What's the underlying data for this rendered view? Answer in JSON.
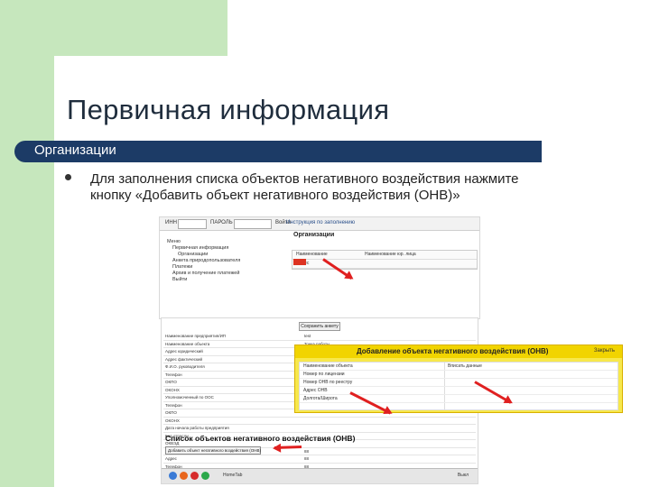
{
  "slide": {
    "title": "Первичная информация",
    "section": "Организации",
    "bullet": "Для заполнения списка объектов негативного воздействия нажмите кнопку «Добавить объект негативного воздействия (ОНВ)»"
  },
  "shot1": {
    "field_inn_label": "ИНН",
    "field_password_label": "ПАРОЛЬ",
    "login_button": "Войти",
    "help_link": "Инструкция по заполнению",
    "tree": [
      "Меню",
      "Первичная информация",
      "Организации",
      "Анкета природопользователя",
      "Платежи",
      "Архив и получение платежей",
      "Выйти"
    ],
    "org_title": "Организации",
    "table_rows": [
      {
        "c1": "Наименование",
        "c2": "Наименование юр. лица"
      },
      {
        "c1": "Адрес",
        "c2": ""
      }
    ]
  },
  "shot2": {
    "save_button": "Сохранить анкету",
    "form_rows": [
      {
        "label": "Наименование предприятия/ИП",
        "value": "test"
      },
      {
        "label": "Наименование объекта",
        "value": "Точка работы"
      },
      {
        "label": "Адрес юридический",
        "value": ""
      },
      {
        "label": "Адрес фактический",
        "value": ""
      },
      {
        "label": "Ф.И.О. руководителя",
        "value": ""
      },
      {
        "label": "Телефон",
        "value": ""
      },
      {
        "label": "ОКПО",
        "value": ""
      },
      {
        "label": "ОКОНХ",
        "value": ""
      },
      {
        "label": "Уполномоченный по ООС",
        "value": ""
      },
      {
        "label": "Телефон",
        "value": ""
      },
      {
        "label": "ОКПО",
        "value": ""
      },
      {
        "label": "ОКОНХ",
        "value": ""
      },
      {
        "label": "Дата начала работы предприятия",
        "value": ""
      },
      {
        "label": "Код отрасли",
        "value": ""
      },
      {
        "label": "ОКВЭД",
        "value": ""
      },
      {
        "label": "Сотрудник",
        "value": "88"
      },
      {
        "label": "Адрес",
        "value": "88"
      },
      {
        "label": "Телефон",
        "value": "88"
      }
    ],
    "list_title": "Список объектов негативного воздействия (ОНВ)",
    "add_button": "Добавить объект негативного воздействия (ОНВ)",
    "taskbar_label": "HomeTab",
    "taskbar_right": "Выкл"
  },
  "dialog": {
    "title": "Добавление объекта негативного воздействия (ОНВ)",
    "close": "Закрыть",
    "rows": [
      {
        "label": "Наименование объекта",
        "value": "Вписать данные"
      },
      {
        "label": "Номер по лицензии",
        "value": ""
      },
      {
        "label": "Номер ОНВ по реестру",
        "value": ""
      },
      {
        "label": "Адрес ОНВ",
        "value": ""
      },
      {
        "label": "Долгота/Широта",
        "value": ""
      }
    ]
  },
  "colors": {
    "green": "#c6e7bd",
    "navy": "#1c3b66",
    "yellow": "#f1d400",
    "red_arrow": "#e02020"
  }
}
